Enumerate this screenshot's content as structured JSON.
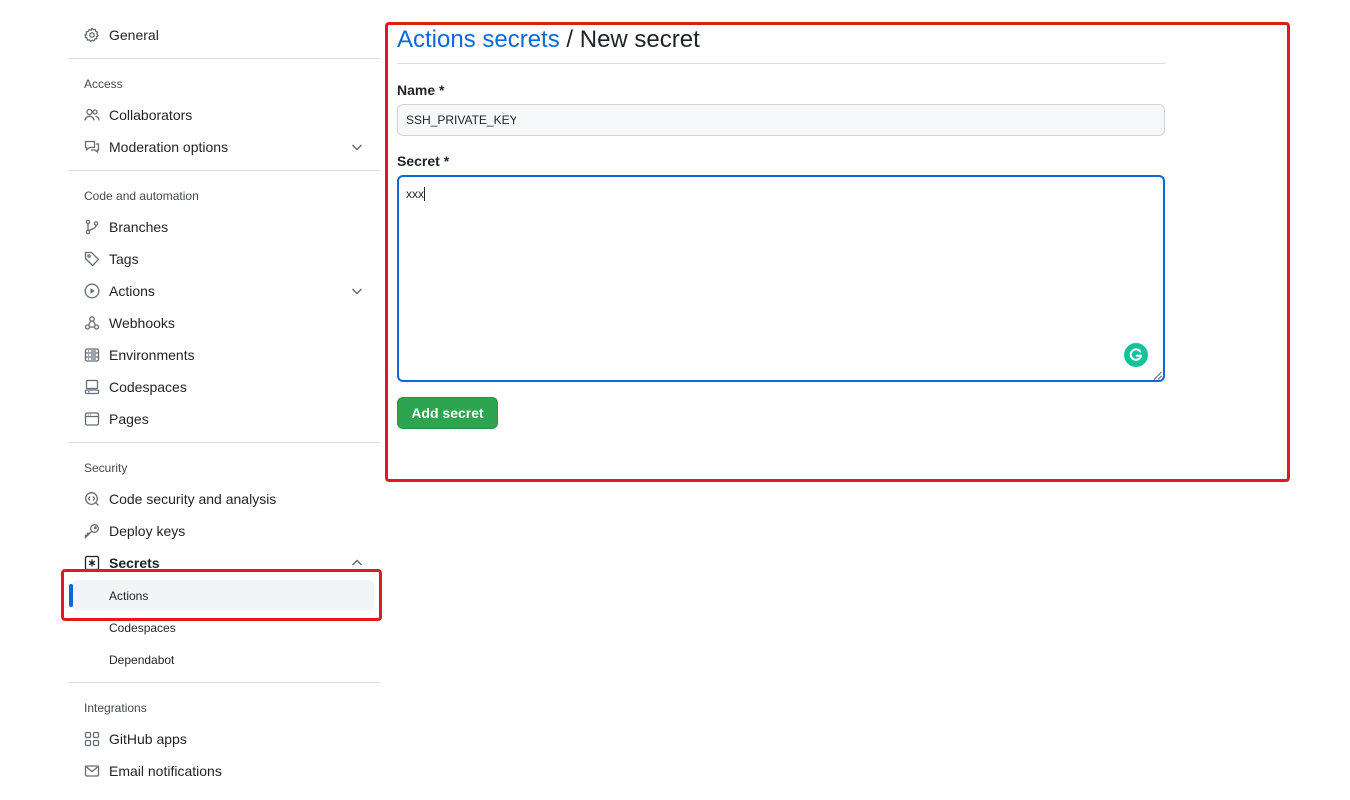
{
  "sidebar": {
    "general": "General",
    "groups": {
      "access": "Access",
      "code_automation": "Code and automation",
      "security": "Security",
      "integrations": "Integrations"
    },
    "items": {
      "collaborators": "Collaborators",
      "moderation": "Moderation options",
      "branches": "Branches",
      "tags": "Tags",
      "actions": "Actions",
      "webhooks": "Webhooks",
      "environments": "Environments",
      "codespaces": "Codespaces",
      "pages": "Pages",
      "code_security": "Code security and analysis",
      "deploy_keys": "Deploy keys",
      "secrets": "Secrets",
      "secrets_actions": "Actions",
      "secrets_codespaces": "Codespaces",
      "secrets_dependabot": "Dependabot",
      "github_apps": "GitHub apps",
      "email_notifications": "Email notifications"
    },
    "active_item": "secrets_actions"
  },
  "main": {
    "breadcrumb_link": "Actions secrets",
    "breadcrumb_current": "/ New secret",
    "name_label": "Name *",
    "name_value": "SSH_PRIVATE_KEY",
    "secret_label": "Secret *",
    "secret_value": "xxx",
    "submit_label": "Add secret"
  },
  "colors": {
    "link": "#0969da",
    "primary_button": "#2da44e",
    "highlight": "#dd1c1c",
    "grammarly": "#15c39a"
  }
}
